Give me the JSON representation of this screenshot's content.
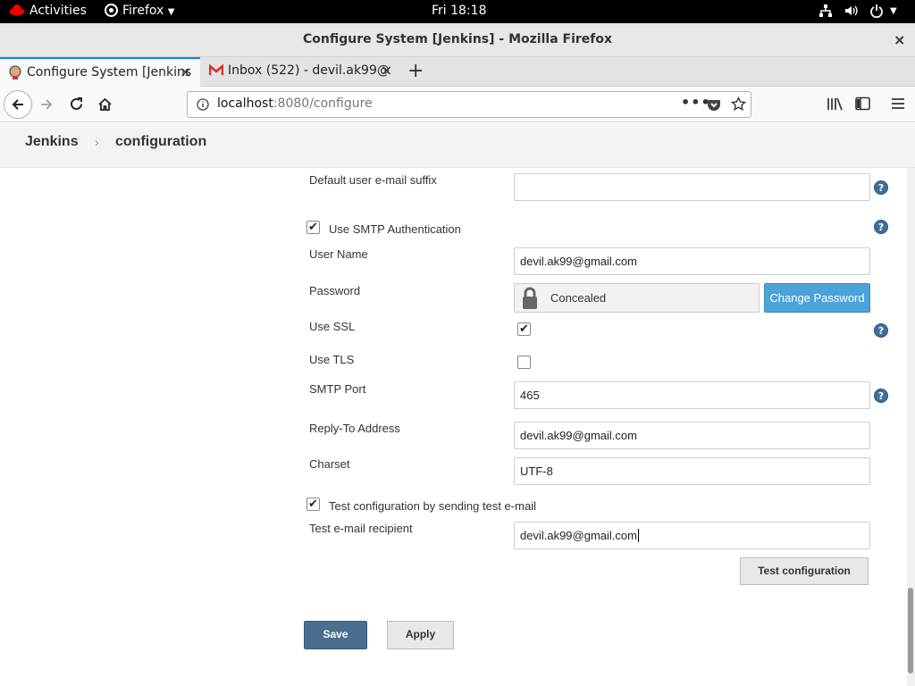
{
  "topbar": {
    "activities": "Activities",
    "app_menu": "Firefox",
    "clock": "Fri 18:18"
  },
  "window": {
    "title": "Configure System [Jenkins] - Mozilla Firefox",
    "close": "×"
  },
  "tabs": [
    {
      "label": "Configure System [Jenkins",
      "close": "×"
    },
    {
      "label": "Inbox (522) - devil.ak99@",
      "close": "×"
    }
  ],
  "new_tab": "+",
  "url": {
    "host": "localhost",
    "rest": ":8080/configure"
  },
  "breadcrumb": {
    "root": "Jenkins",
    "separator": "›",
    "current": "configuration"
  },
  "form": {
    "default_suffix_label": "Default user e-mail suffix",
    "default_suffix_value": "",
    "smtp_auth_label": "Use SMTP Authentication",
    "smtp_auth_checked": true,
    "username_label": "User Name",
    "username_value": "devil.ak99@gmail.com",
    "password_label": "Password",
    "password_value": "Concealed",
    "change_password": "Change Password",
    "use_ssl_label": "Use SSL",
    "use_ssl_checked": true,
    "use_tls_label": "Use TLS",
    "use_tls_checked": false,
    "smtp_port_label": "SMTP Port",
    "smtp_port_value": "465",
    "reply_to_label": "Reply-To Address",
    "reply_to_value": "devil.ak99@gmail.com",
    "charset_label": "Charset",
    "charset_value": "UTF-8",
    "test_config_label": "Test configuration by sending test e-mail",
    "test_config_checked": true,
    "test_recipient_label": "Test e-mail recipient",
    "test_recipient_value": "devil.ak99@gmail.com",
    "test_button": "Test configuration",
    "save_button": "Save",
    "apply_button": "Apply"
  },
  "icons": {
    "check": "✔",
    "help": "?"
  },
  "colors": {
    "save_button": "#4a6e8e",
    "change_password_button": "#4ba3d9",
    "tab_accent": "#0a84ff"
  }
}
